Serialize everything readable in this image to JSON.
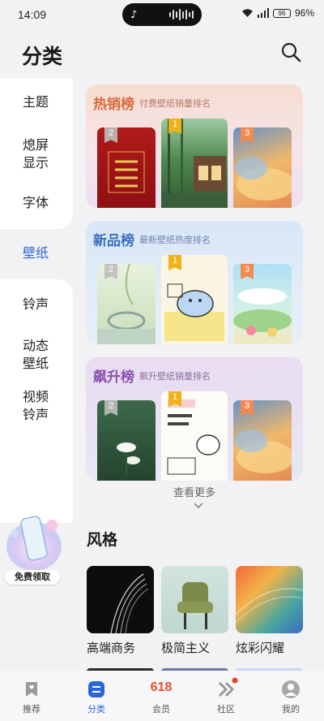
{
  "status": {
    "time": "14:09",
    "battery": "96",
    "battery_pct": "96%"
  },
  "header": {
    "title": "分类"
  },
  "sidebar": {
    "items": [
      {
        "label": "主题"
      },
      {
        "label": "熄屏\n显示"
      },
      {
        "label": "字体"
      },
      {
        "label": "壁纸"
      },
      {
        "label": "铃声"
      },
      {
        "label": "动态\n壁纸"
      },
      {
        "label": "视频\n铃声"
      }
    ],
    "active_index": 3
  },
  "rankings": [
    {
      "title": "热销榜",
      "subtitle": "付费壁纸销量排名",
      "ranks": [
        "2",
        "1",
        "3"
      ]
    },
    {
      "title": "新品榜",
      "subtitle": "最新壁纸热度排名",
      "ranks": [
        "2",
        "1",
        "3"
      ]
    },
    {
      "title": "飙升榜",
      "subtitle": "飙升壁纸销量排名",
      "ranks": [
        "2",
        "1",
        "3"
      ]
    }
  ],
  "see_more": "查看更多",
  "styles": {
    "title": "风格",
    "items": [
      {
        "label": "高端商务"
      },
      {
        "label": "极简主义"
      },
      {
        "label": "炫彩闪耀"
      }
    ]
  },
  "promo": {
    "button": "免费领取"
  },
  "tabbar": {
    "items": [
      {
        "label": "推荐"
      },
      {
        "label": "分类"
      },
      {
        "label": "会员",
        "icon_text": "618"
      },
      {
        "label": "社区"
      },
      {
        "label": "我的"
      }
    ],
    "active_index": 1
  },
  "colors": {
    "accent": "#2a66d9",
    "hot": "#e07a4a",
    "new": "#3a6fbf",
    "rise": "#8a4fb0"
  }
}
